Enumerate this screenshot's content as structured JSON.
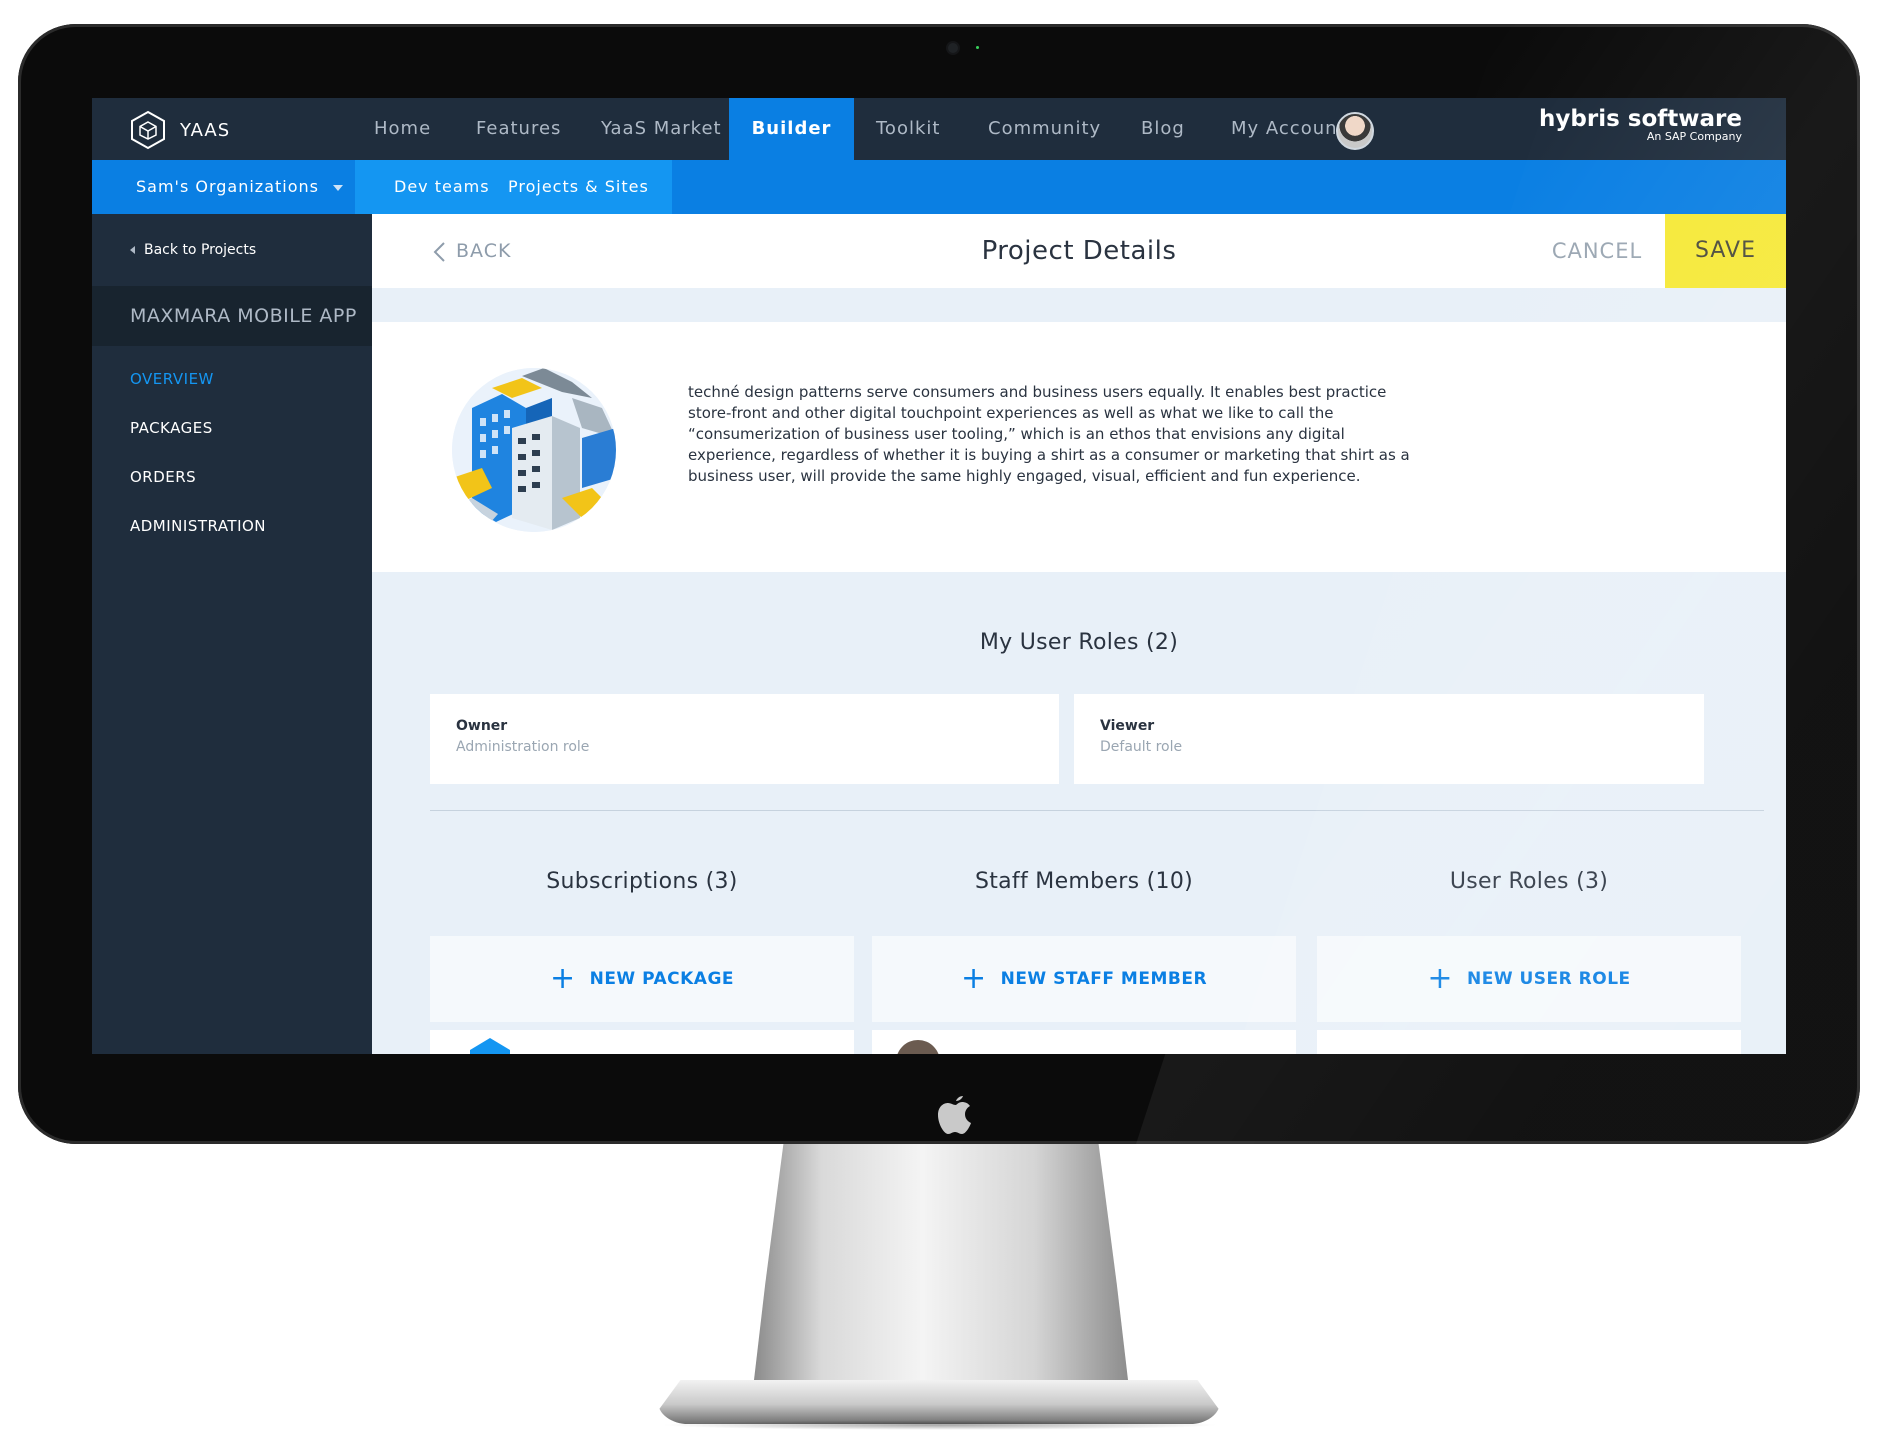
{
  "topnav": {
    "logo_text": "YAAS",
    "items": [
      {
        "label": "Home"
      },
      {
        "label": "Features"
      },
      {
        "label": "YaaS Market"
      },
      {
        "label": "Builder"
      },
      {
        "label": "Toolkit"
      },
      {
        "label": "Community"
      },
      {
        "label": "Blog"
      },
      {
        "label": "My Account"
      }
    ],
    "active_item": "Builder",
    "brand_name": "hybris software",
    "brand_tagline": "An SAP Company"
  },
  "subnav": {
    "org_label": "Sam's Organizations",
    "tabs": [
      {
        "label": "Dev teams"
      },
      {
        "label": "Projects & Sites"
      }
    ]
  },
  "sidebar": {
    "back_label": "Back to Projects",
    "project_name": "MAXMARA MOBILE APP",
    "items": [
      {
        "label": "OVERVIEW"
      },
      {
        "label": "PACKAGES"
      },
      {
        "label": "ORDERS"
      },
      {
        "label": "ADMINISTRATION"
      }
    ],
    "active_item": "OVERVIEW"
  },
  "header": {
    "back_label": "BACK",
    "title": "Project Details",
    "cancel_label": "CANCEL",
    "save_label": "SAVE"
  },
  "description": "techné design patterns serve consumers and business users equally. It enables best practice store-front and other digital touchpoint experiences as well as what we like to call the “consumerization of business user tooling,” which is an ethos that envisions any digital experience, regardless of whether it is buying a shirt as a consumer or marketing that shirt as a business user, will provide the same highly engaged, visual, efficient and fun experience.",
  "my_user_roles": {
    "title": "My User Roles (2)",
    "roles": [
      {
        "name": "Owner",
        "description": "Administration role"
      },
      {
        "name": "Viewer",
        "description": "Default role"
      }
    ]
  },
  "sections": [
    {
      "title": "Subscriptions (3)",
      "add_label": "NEW PACKAGE"
    },
    {
      "title": "Staff Members (10)",
      "add_label": "NEW STAFF MEMBER"
    },
    {
      "title": "User Roles (3)",
      "add_label": "NEW USER ROLE"
    }
  ],
  "colors": {
    "nav_dark": "#1f2d3d",
    "accent_blue": "#0a7fe3",
    "save_yellow": "#f6e937",
    "content_bg": "#e8f0f8"
  }
}
